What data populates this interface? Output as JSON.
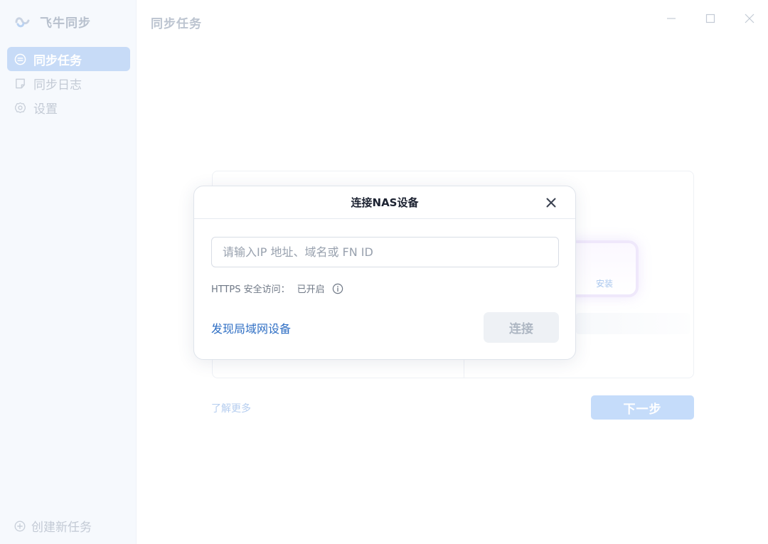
{
  "app": {
    "name": "飞牛同步",
    "page_title": "同步任务"
  },
  "sidebar": {
    "items": [
      {
        "label": "同步任务",
        "icon": "sync-list-icon",
        "active": true
      },
      {
        "label": "同步日志",
        "icon": "log-note-icon",
        "active": false
      },
      {
        "label": "设置",
        "icon": "gear-icon",
        "active": false
      }
    ],
    "create_task": {
      "label": "创建新任务",
      "icon": "plus-circle-icon"
    }
  },
  "window_controls": [
    "minimize-icon",
    "maximize-icon",
    "close-icon"
  ],
  "background": {
    "install_label": "安装",
    "learn_more": "了解更多",
    "next_button": "下一步"
  },
  "dialog": {
    "title": "连接NAS设备",
    "input": {
      "value": "",
      "placeholder": "请输入IP 地址、域名或 FN ID"
    },
    "https_label": "HTTPS 安全访问：",
    "https_status": "已开启",
    "discover_link": "发现局域网设备",
    "connect_button": "连接"
  },
  "colors": {
    "accent": "#2f6fc4",
    "sidebar_active_bg": "#c7dbf7",
    "next_button_bg": "#c5dcfa"
  }
}
